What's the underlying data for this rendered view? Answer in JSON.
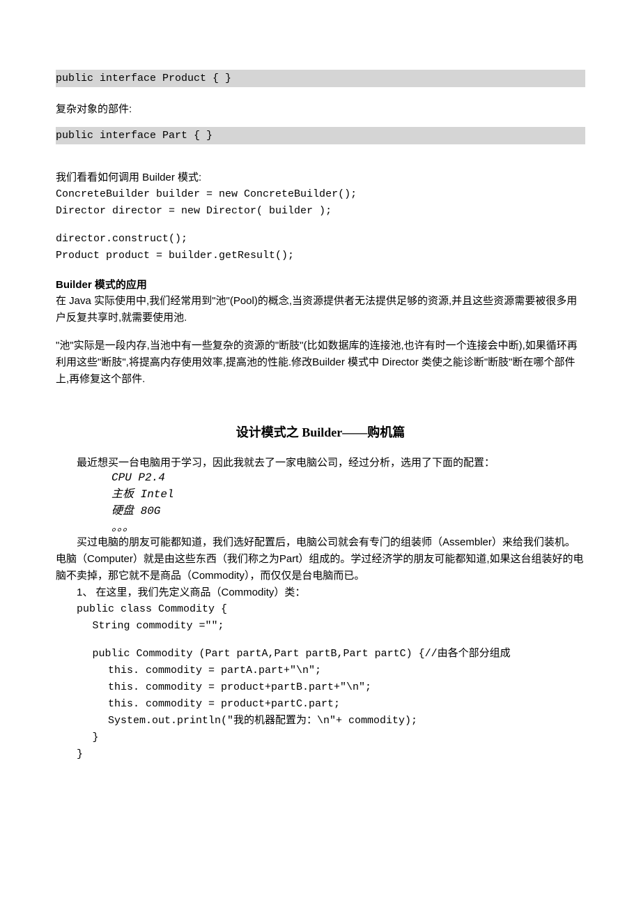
{
  "codeBlock1": "public interface Product { }",
  "label1": "复杂对象的部件:",
  "codeBlock2": "public interface Part { }",
  "usage": {
    "intro": "我们看看如何调用 Builder 模式:",
    "line1": "ConcreteBuilder builder = new ConcreteBuilder();",
    "line2": "Director director = new Director( builder );",
    "line3": "director.construct();",
    "line4": "Product product = builder.getResult();"
  },
  "app": {
    "heading": "Builder 模式的应用",
    "p1": "在 Java 实际使用中,我们经常用到\"池\"(Pool)的概念,当资源提供者无法提供足够的资源,并且这些资源需要被很多用户反复共享时,就需要使用池.",
    "p2": "\"池\"实际是一段内存,当池中有一些复杂的资源的\"断肢\"(比如数据库的连接池,也许有时一个连接会中断),如果循环再利用这些\"断肢\",将提高内存使用效率,提高池的性能.修改Builder 模式中 Director 类使之能诊断\"断肢\"断在哪个部件上,再修复这个部件."
  },
  "article": {
    "title": "设计模式之 Builder——购机篇",
    "intro": "最近想买一台电脑用于学习，因此我就去了一家电脑公司，经过分析，选用了下面的配置：",
    "config": {
      "cpu": "CPU P2.4",
      "board": "主板  Intel",
      "disk": "硬盘  80G",
      "etc": "。。。"
    },
    "p2a": "买过电脑的朋友可能都知道，我们选好配置后，电脑公司就会有专门的组装师（Assembler）来给我们装机。电脑（Computer）就是由这些东西（我们称之为Part）组成的。学过经济学的朋友可能都知道,如果这台组装好的电脑不卖掉，那它就不是商品（Commodity），而仅仅是台电脑而已。",
    "step1": "1、 在这里，我们先定义商品（Commodity）类：",
    "code": {
      "l1": "public class Commodity {",
      "l2": "String commodity =\"\";",
      "l3": "public Commodity (Part partA,Part partB,Part partC) {//由各个部分组成",
      "l4": "this. commodity = partA.part+\"\\n\";",
      "l5": "this. commodity = product+partB.part+\"\\n\";",
      "l6": "this. commodity = product+partC.part;",
      "l7": "System.out.println(\"我的机器配置为：\\n\"+ commodity);",
      "l8": "}",
      "l9": "}"
    }
  }
}
